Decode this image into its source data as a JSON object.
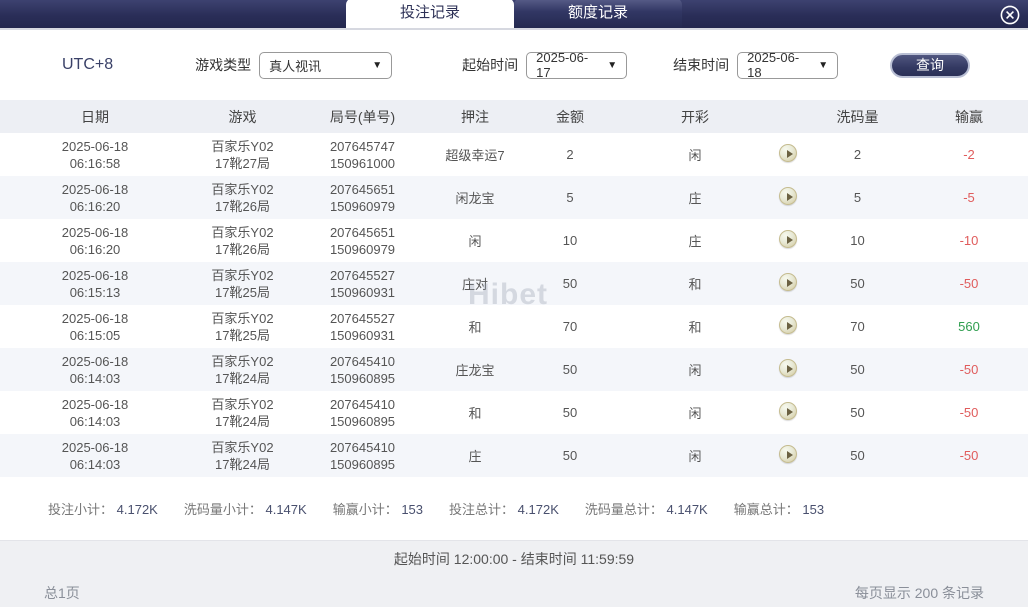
{
  "window": {
    "tabs": [
      {
        "label": "投注记录",
        "active": true
      },
      {
        "label": "额度记录",
        "active": false
      }
    ]
  },
  "filters": {
    "timezone": "UTC+8",
    "game_type": {
      "label": "游戏类型",
      "value": "真人视讯"
    },
    "start_time": {
      "label": "起始时间",
      "value": "2025-06-17"
    },
    "end_time": {
      "label": "结束时间",
      "value": "2025-06-18"
    },
    "query_button": "查询"
  },
  "table": {
    "headers": {
      "date": "日期",
      "game": "游戏",
      "round": "局号(单号)",
      "bet": "押注",
      "amount": "金额",
      "result": "开彩",
      "wash": "洗码量",
      "winloss": "输赢"
    },
    "rows": [
      {
        "date": "2025-06-18",
        "time": "06:16:58",
        "game_name": "百家乐Y02",
        "game_round": "17靴27局",
        "round_no": "207645747",
        "order_no": "150961000",
        "bet_type": "超级幸运7",
        "amount": "2",
        "result": "闲",
        "wash_amount": "2",
        "win_loss": "-2"
      },
      {
        "date": "2025-06-18",
        "time": "06:16:20",
        "game_name": "百家乐Y02",
        "game_round": "17靴26局",
        "round_no": "207645651",
        "order_no": "150960979",
        "bet_type": "闲龙宝",
        "amount": "5",
        "result": "庄",
        "wash_amount": "5",
        "win_loss": "-5"
      },
      {
        "date": "2025-06-18",
        "time": "06:16:20",
        "game_name": "百家乐Y02",
        "game_round": "17靴26局",
        "round_no": "207645651",
        "order_no": "150960979",
        "bet_type": "闲",
        "amount": "10",
        "result": "庄",
        "wash_amount": "10",
        "win_loss": "-10"
      },
      {
        "date": "2025-06-18",
        "time": "06:15:13",
        "game_name": "百家乐Y02",
        "game_round": "17靴25局",
        "round_no": "207645527",
        "order_no": "150960931",
        "bet_type": "庄对",
        "amount": "50",
        "result": "和",
        "wash_amount": "50",
        "win_loss": "-50"
      },
      {
        "date": "2025-06-18",
        "time": "06:15:05",
        "game_name": "百家乐Y02",
        "game_round": "17靴25局",
        "round_no": "207645527",
        "order_no": "150960931",
        "bet_type": "和",
        "amount": "70",
        "result": "和",
        "wash_amount": "70",
        "win_loss": "560"
      },
      {
        "date": "2025-06-18",
        "time": "06:14:03",
        "game_name": "百家乐Y02",
        "game_round": "17靴24局",
        "round_no": "207645410",
        "order_no": "150960895",
        "bet_type": "庄龙宝",
        "amount": "50",
        "result": "闲",
        "wash_amount": "50",
        "win_loss": "-50"
      },
      {
        "date": "2025-06-18",
        "time": "06:14:03",
        "game_name": "百家乐Y02",
        "game_round": "17靴24局",
        "round_no": "207645410",
        "order_no": "150960895",
        "bet_type": "和",
        "amount": "50",
        "result": "闲",
        "wash_amount": "50",
        "win_loss": "-50"
      },
      {
        "date": "2025-06-18",
        "time": "06:14:03",
        "game_name": "百家乐Y02",
        "game_round": "17靴24局",
        "round_no": "207645410",
        "order_no": "150960895",
        "bet_type": "庄",
        "amount": "50",
        "result": "闲",
        "wash_amount": "50",
        "win_loss": "-50"
      }
    ]
  },
  "summary": [
    {
      "label": "投注小计：",
      "value": "4.172K"
    },
    {
      "label": "洗码量小计：",
      "value": "4.147K"
    },
    {
      "label": "输赢小计：",
      "value": "153"
    },
    {
      "label": "投注总计：",
      "value": "4.172K"
    },
    {
      "label": "洗码量总计：",
      "value": "4.147K"
    },
    {
      "label": "输赢总计：",
      "value": "153"
    }
  ],
  "footer": {
    "time_range": "起始时间 12:00:00 - 结束时间 11:59:59",
    "page_info": "总1页",
    "per_page": "每页显示 200 条记录"
  },
  "watermark": "Hibet",
  "colors": {
    "negative": "#e05c5c",
    "positive": "#2f9e4f",
    "accent_navy": "#2b2f5c"
  }
}
